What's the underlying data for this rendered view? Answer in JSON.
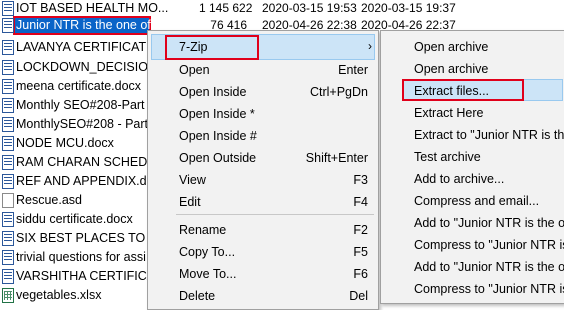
{
  "files": [
    {
      "name": "IOT BASED HEALTH MO...",
      "size": "1 145 622",
      "date": "2020-03-15 19:53",
      "date2": "2020-03-15 19:37",
      "icon": "word-doc-icon"
    },
    {
      "name": "Junior NTR is the one of...",
      "size": "76 416",
      "date": "2020-04-26 22:38",
      "date2": "2020-04-26 22:37",
      "icon": "word-doc-icon",
      "selected": true
    },
    {
      "name": "LAVANYA CERTIFICATES...",
      "icon": "word-doc-icon"
    },
    {
      "name": "LOCKDOWN_DECISION...",
      "icon": "word-doc-icon"
    },
    {
      "name": "meena certificate.docx",
      "icon": "word-doc-icon"
    },
    {
      "name": "Monthly SEO#208-Part ...",
      "icon": "word-doc-icon"
    },
    {
      "name": "MonthlySEO#208 - Part ...",
      "icon": "word-doc-icon"
    },
    {
      "name": "NODE MCU.docx",
      "icon": "word-doc-icon"
    },
    {
      "name": "RAM CHARAN SCHEDU...",
      "icon": "word-doc-icon"
    },
    {
      "name": "REF AND APPENDIX.docx",
      "icon": "word-doc-icon"
    },
    {
      "name": "Rescue.asd",
      "icon": "blank-file-icon"
    },
    {
      "name": "siddu certificate.docx",
      "icon": "word-doc-icon"
    },
    {
      "name": "SIX BEST PLACES TO SEL...",
      "icon": "word-doc-icon"
    },
    {
      "name": "trivial questions for assi...",
      "icon": "word-doc-icon"
    },
    {
      "name": "VARSHITHA CERTIFICAT...",
      "icon": "word-doc-icon"
    },
    {
      "name": "vegetables.xlsx",
      "icon": "excel-icon"
    }
  ],
  "context_menu": {
    "items": [
      {
        "label": "7-Zip",
        "shortcut": "",
        "submenu": true
      },
      {
        "label": "Open",
        "shortcut": "Enter"
      },
      {
        "label": "Open Inside",
        "shortcut": "Ctrl+PgDn"
      },
      {
        "label": "Open Inside *",
        "shortcut": ""
      },
      {
        "label": "Open Inside #",
        "shortcut": ""
      },
      {
        "label": "Open Outside",
        "shortcut": "Shift+Enter"
      },
      {
        "label": "View",
        "shortcut": "F3"
      },
      {
        "label": "Edit",
        "shortcut": "F4"
      },
      {
        "label": "Rename",
        "shortcut": "F2"
      },
      {
        "label": "Copy To...",
        "shortcut": "F5"
      },
      {
        "label": "Move To...",
        "shortcut": "F6"
      },
      {
        "label": "Delete",
        "shortcut": "Del"
      }
    ],
    "submenu_arrow": "›"
  },
  "zip_submenu": {
    "items": [
      {
        "label": "Open archive"
      },
      {
        "label": "Open archive"
      },
      {
        "label": "Extract files..."
      },
      {
        "label": "Extract Here"
      },
      {
        "label": "Extract to \"Junior NTR is the o"
      },
      {
        "label": "Test archive"
      },
      {
        "label": "Add to archive..."
      },
      {
        "label": "Compress and email..."
      },
      {
        "label": "Add to \"Junior NTR is the one"
      },
      {
        "label": "Compress to \"Junior NTR is the"
      },
      {
        "label": "Add to \"Junior NTR is the one"
      },
      {
        "label": "Compress to \"Junior NTR is the"
      }
    ]
  },
  "colors": {
    "highlight_border": "#e0001b",
    "selection": "#0a64c8",
    "hover": "#cce4f7"
  }
}
